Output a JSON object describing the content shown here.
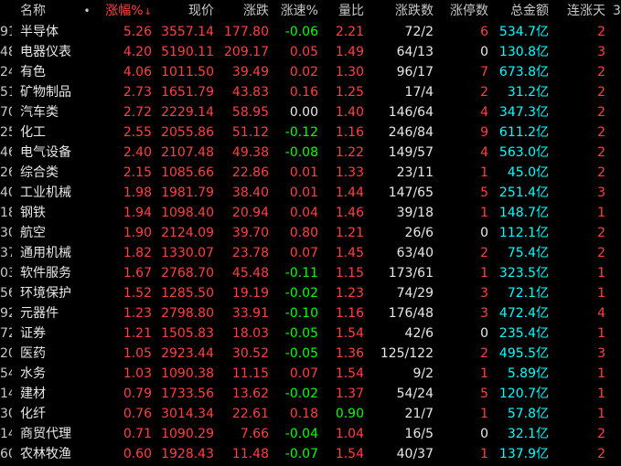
{
  "header": {
    "name": "名称",
    "dot": "•",
    "pct": "涨幅%",
    "pct_arrow": "↓",
    "price": "现价",
    "chg": "涨跌",
    "speed": "涨速%",
    "vr": "量比",
    "ud": "涨跌数",
    "lim": "涨停数",
    "amt": "总金额",
    "days": "连涨天",
    "more": "3"
  },
  "colors": {
    "up": "#ff4040",
    "down": "#00ff00",
    "flat": "#e8e8e8",
    "amount": "#00ffff",
    "background": "#000000"
  },
  "rows": [
    {
      "code": "91",
      "name": "半导体",
      "pct": "5.26",
      "price": "3557.14",
      "chg": "177.80",
      "speed": "-0.06",
      "vr": "2.21",
      "ud": "72/2",
      "lim": "6",
      "amt": "534.7",
      "unit": "亿",
      "days": "2"
    },
    {
      "code": "48",
      "name": "电器仪表",
      "pct": "4.20",
      "price": "5190.11",
      "chg": "209.17",
      "speed": "0.05",
      "vr": "1.49",
      "ud": "64/13",
      "lim": "0",
      "amt": "130.8",
      "unit": "亿",
      "days": "3"
    },
    {
      "code": "24",
      "name": "有色",
      "pct": "4.06",
      "price": "1011.50",
      "chg": "39.49",
      "speed": "0.02",
      "vr": "1.30",
      "ud": "96/17",
      "lim": "7",
      "amt": "673.8",
      "unit": "亿",
      "days": "2"
    },
    {
      "code": "51",
      "name": "矿物制品",
      "pct": "2.73",
      "price": "1651.79",
      "chg": "43.83",
      "speed": "0.16",
      "vr": "1.25",
      "ud": "17/4",
      "lim": "2",
      "amt": "31.2",
      "unit": "亿",
      "days": "2"
    },
    {
      "code": "70",
      "name": "汽车类",
      "pct": "2.72",
      "price": "2229.14",
      "chg": "58.95",
      "speed": "0.00",
      "vr": "1.40",
      "ud": "146/64",
      "lim": "4",
      "amt": "347.3",
      "unit": "亿",
      "days": "2"
    },
    {
      "code": "25",
      "name": "化工",
      "pct": "2.55",
      "price": "2055.86",
      "chg": "51.12",
      "speed": "-0.12",
      "vr": "1.16",
      "ud": "246/84",
      "lim": "9",
      "amt": "611.2",
      "unit": "亿",
      "days": "2"
    },
    {
      "code": "46",
      "name": "电气设备",
      "pct": "2.40",
      "price": "2107.48",
      "chg": "49.38",
      "speed": "-0.08",
      "vr": "1.22",
      "ud": "149/57",
      "lim": "4",
      "amt": "563.0",
      "unit": "亿",
      "days": "2"
    },
    {
      "code": "26",
      "name": "综合类",
      "pct": "2.15",
      "price": "1085.66",
      "chg": "22.86",
      "speed": "0.01",
      "vr": "1.33",
      "ud": "23/11",
      "lim": "1",
      "amt": "45.0",
      "unit": "亿",
      "days": "2"
    },
    {
      "code": "40",
      "name": "工业机械",
      "pct": "1.98",
      "price": "1981.79",
      "chg": "38.40",
      "speed": "0.01",
      "vr": "1.44",
      "ud": "147/65",
      "lim": "5",
      "amt": "251.4",
      "unit": "亿",
      "days": "3"
    },
    {
      "code": "18",
      "name": "钢铁",
      "pct": "1.94",
      "price": "1098.40",
      "chg": "20.94",
      "speed": "0.04",
      "vr": "1.46",
      "ud": "39/18",
      "lim": "1",
      "amt": "148.7",
      "unit": "亿",
      "days": "1"
    },
    {
      "code": "30",
      "name": "航空",
      "pct": "1.90",
      "price": "2124.09",
      "chg": "39.70",
      "speed": "0.80",
      "vr": "1.21",
      "ud": "26/6",
      "lim": "0",
      "amt": "112.1",
      "unit": "亿",
      "days": "2"
    },
    {
      "code": "37",
      "name": "通用机械",
      "pct": "1.82",
      "price": "1330.07",
      "chg": "23.78",
      "speed": "0.07",
      "vr": "1.45",
      "ud": "63/40",
      "lim": "2",
      "amt": "75.4",
      "unit": "亿",
      "days": "2"
    },
    {
      "code": "03",
      "name": "软件服务",
      "pct": "1.67",
      "price": "2768.70",
      "chg": "45.48",
      "speed": "-0.11",
      "vr": "1.15",
      "ud": "173/61",
      "lim": "1",
      "amt": "323.5",
      "unit": "亿",
      "days": "1"
    },
    {
      "code": "56",
      "name": "环境保护",
      "pct": "1.52",
      "price": "1285.50",
      "chg": "19.19",
      "speed": "-0.02",
      "vr": "1.23",
      "ud": "74/29",
      "lim": "3",
      "amt": "72.1",
      "unit": "亿",
      "days": "1"
    },
    {
      "code": "92",
      "name": "元器件",
      "pct": "1.23",
      "price": "2798.80",
      "chg": "33.91",
      "speed": "-0.10",
      "vr": "1.16",
      "ud": "176/48",
      "lim": "3",
      "amt": "472.4",
      "unit": "亿",
      "days": "4"
    },
    {
      "code": "72",
      "name": "证券",
      "pct": "1.21",
      "price": "1505.83",
      "chg": "18.03",
      "speed": "-0.05",
      "vr": "1.54",
      "ud": "42/6",
      "lim": "0",
      "amt": "235.4",
      "unit": "亿",
      "days": "1"
    },
    {
      "code": "20",
      "name": "医药",
      "pct": "1.05",
      "price": "2923.44",
      "chg": "30.52",
      "speed": "-0.05",
      "vr": "1.36",
      "ud": "125/122",
      "lim": "2",
      "amt": "495.5",
      "unit": "亿",
      "days": "3"
    },
    {
      "code": "54",
      "name": "水务",
      "pct": "1.03",
      "price": "1090.38",
      "chg": "11.15",
      "speed": "0.07",
      "vr": "1.54",
      "ud": "9/2",
      "lim": "1",
      "amt": "5.89",
      "unit": "亿",
      "days": "1"
    },
    {
      "code": "14",
      "name": "建材",
      "pct": "0.79",
      "price": "1733.56",
      "chg": "13.62",
      "speed": "-0.02",
      "vr": "1.37",
      "ud": "54/24",
      "lim": "5",
      "amt": "120.7",
      "unit": "亿",
      "days": "1"
    },
    {
      "code": "30",
      "name": "化纤",
      "pct": "0.76",
      "price": "3014.34",
      "chg": "22.61",
      "speed": "0.18",
      "vr": "0.90",
      "ud": "21/7",
      "lim": "1",
      "amt": "57.8",
      "unit": "亿",
      "days": "1"
    },
    {
      "code": "14",
      "name": "商贸代理",
      "pct": "0.71",
      "price": "1090.29",
      "chg": "7.66",
      "speed": "-0.04",
      "vr": "1.04",
      "ud": "16/5",
      "lim": "0",
      "amt": "32.1",
      "unit": "亿",
      "days": "2"
    },
    {
      "code": "60",
      "name": "农林牧渔",
      "pct": "0.60",
      "price": "1928.43",
      "chg": "11.48",
      "speed": "-0.07",
      "vr": "1.54",
      "ud": "40/37",
      "lim": "1",
      "amt": "137.9",
      "unit": "亿",
      "days": "2"
    }
  ]
}
